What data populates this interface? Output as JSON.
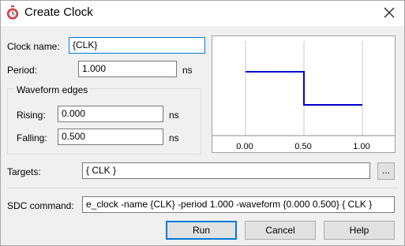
{
  "window": {
    "title": "Create Clock",
    "close_glyph": "✕"
  },
  "clock_name": {
    "label": "Clock name:",
    "value": "{CLK}"
  },
  "period": {
    "label": "Period:",
    "value": "1.000",
    "unit": "ns"
  },
  "waveform_edges": {
    "title": "Waveform edges",
    "rising": {
      "label": "Rising:",
      "value": "0.000",
      "unit": "ns"
    },
    "falling": {
      "label": "Falling:",
      "value": "0.500",
      "unit": "ns"
    }
  },
  "waveform_preview": {
    "tick_labels": [
      "0.00",
      "0.50",
      "1.00"
    ],
    "line_color": "#0000cc",
    "signal": [
      {
        "t": 0.0,
        "level": 1
      },
      {
        "t": 0.5,
        "level": 1
      },
      {
        "t": 0.5,
        "level": 0
      },
      {
        "t": 1.0,
        "level": 0
      }
    ]
  },
  "targets": {
    "label": "Targets:",
    "value": "{ CLK }",
    "browse_label": "..."
  },
  "sdc_command": {
    "label": "SDC command:",
    "value": "e_clock -name {CLK} -period 1.000 -waveform {0.000 0.500} { CLK }"
  },
  "buttons": {
    "run": "Run",
    "cancel": "Cancel",
    "help": "Help"
  },
  "colors": {
    "accent": "#0078d7",
    "icon_red": "#d9434f"
  },
  "icons": {
    "app": "stopwatch-icon",
    "close": "close-icon"
  }
}
